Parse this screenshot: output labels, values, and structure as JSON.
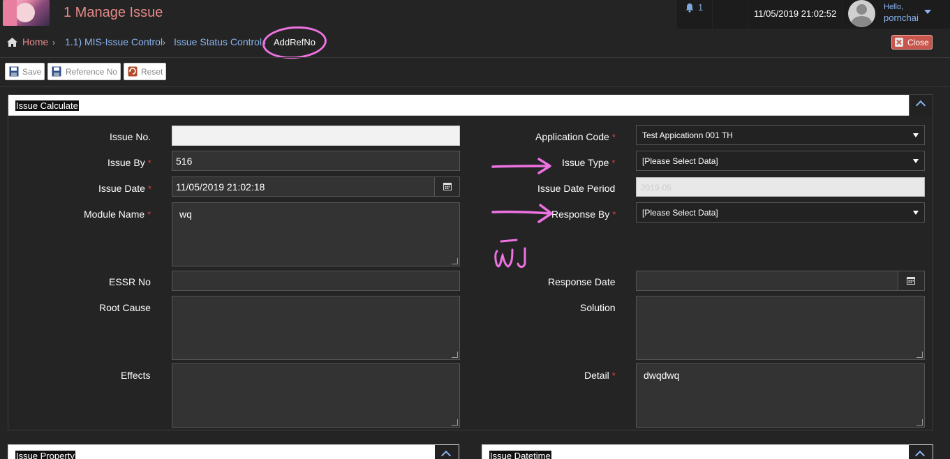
{
  "header": {
    "app_title": "1 Manage Issue",
    "notification_count": "1",
    "datetime": "11/05/2019 21:02:52",
    "greeting": "Hello,",
    "username": "pornchai"
  },
  "breadcrumb": {
    "home": "Home",
    "items": [
      "1.1) MIS-Issue Control",
      "Issue Status Control"
    ],
    "current": "AddRefNo",
    "separator": "›"
  },
  "close_label": "Close",
  "toolbar": {
    "save_label": "Save",
    "reference_label": "Reference No",
    "reset_label": "Reset"
  },
  "panel": {
    "title": "Issue Calculate",
    "fields": {
      "issue_no": {
        "label": "Issue No.",
        "value": ""
      },
      "issue_by": {
        "label": "Issue By",
        "value": "516"
      },
      "issue_date": {
        "label": "Issue Date",
        "value": "11/05/2019 21:02:18"
      },
      "module_name": {
        "label": "Module Name",
        "value": "wq"
      },
      "essr_no": {
        "label": "ESSR No",
        "value": ""
      },
      "root_cause": {
        "label": "Root Cause",
        "value": ""
      },
      "effects": {
        "label": "Effects",
        "value": ""
      },
      "application_code": {
        "label": "Application Code",
        "value": "Test Appicationn 001 TH"
      },
      "issue_type": {
        "label": "Issue Type",
        "value": "[Please Select Data]"
      },
      "issue_date_period": {
        "label": "Issue Date Period",
        "value": "2019-05"
      },
      "response_by": {
        "label": "Response By",
        "value": "[Please Select Data]"
      },
      "response_date": {
        "label": "Response Date",
        "value": ""
      },
      "solution": {
        "label": "Solution",
        "value": ""
      },
      "detail": {
        "label": "Detail",
        "value": "dwqdwq"
      }
    },
    "required_mark": "*"
  },
  "subpanels": {
    "left_title": "Issue Property",
    "right_title": "Issue Datetime"
  },
  "annotation": {
    "handwritten_text": "พีJ",
    "color": "#ee72e2"
  },
  "colors": {
    "title_accent": "#e88a8a",
    "link": "#8ab4f0",
    "close_button": "#c9564c",
    "required": "#e04040"
  },
  "icons": [
    "bell-icon",
    "home-icon",
    "save-icon",
    "reference-icon",
    "reset-icon",
    "close-icon",
    "calendar-icon",
    "chevron-up-icon",
    "chevron-down-icon"
  ]
}
